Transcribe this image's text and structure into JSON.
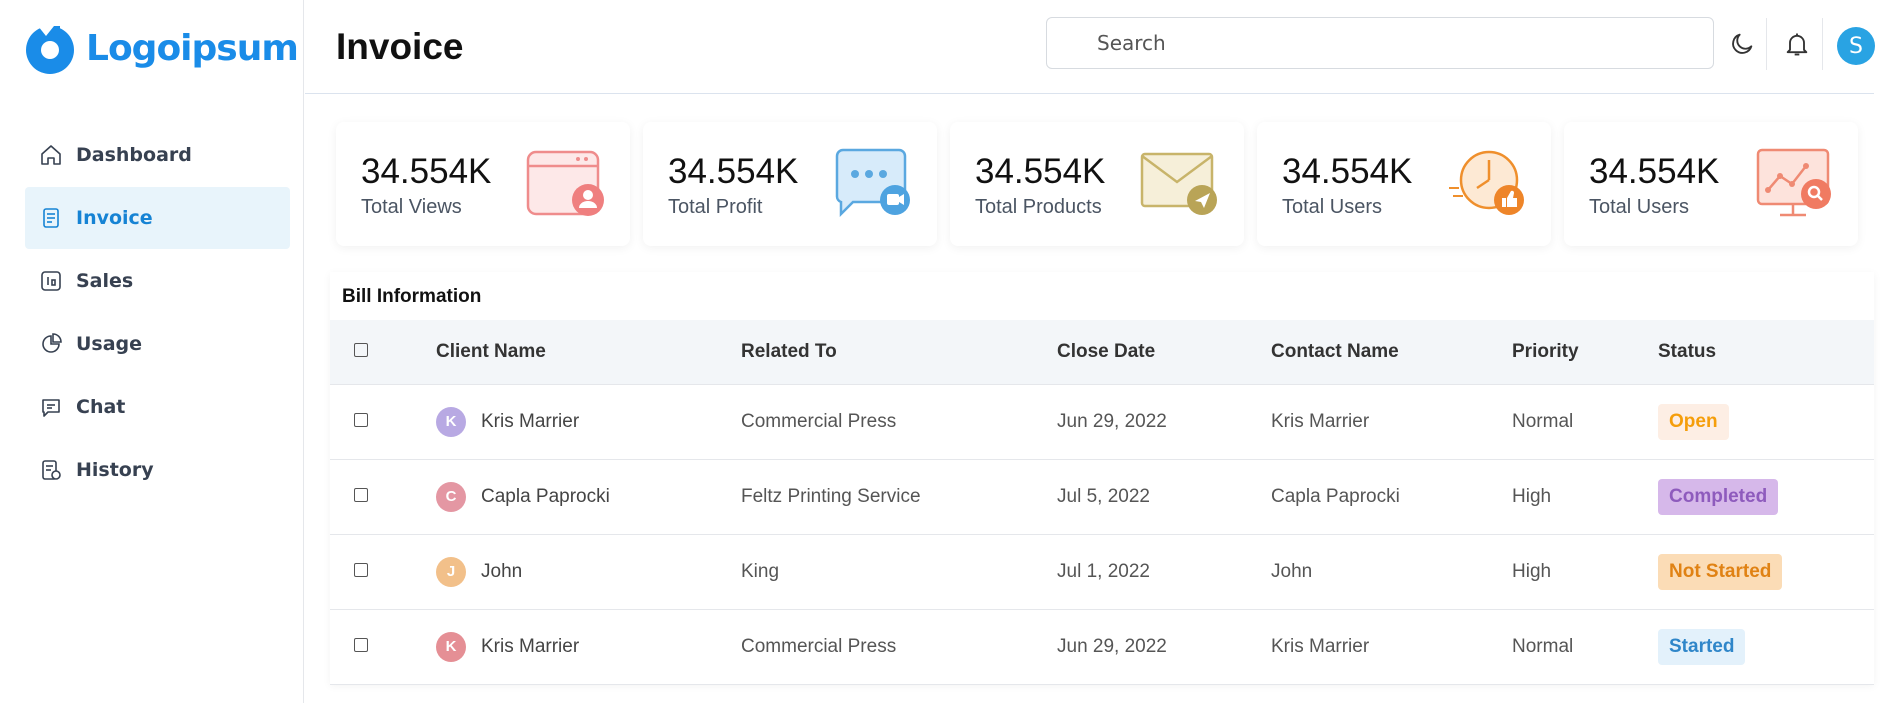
{
  "brand": {
    "name": "Logoipsum",
    "color": "#1a8ce8"
  },
  "sidebar": {
    "items": [
      {
        "label": "Dashboard",
        "icon": "home-icon",
        "active": false
      },
      {
        "label": "Invoice",
        "icon": "invoice-icon",
        "active": true
      },
      {
        "label": "Sales",
        "icon": "sales-icon",
        "active": false
      },
      {
        "label": "Usage",
        "icon": "pie-icon",
        "active": false
      },
      {
        "label": "Chat",
        "icon": "chat-icon",
        "active": false
      },
      {
        "label": "History",
        "icon": "history-icon",
        "active": false
      }
    ]
  },
  "header": {
    "title": "Invoice",
    "search_placeholder": "Search",
    "theme_icon": "moon-icon",
    "notification_icon": "bell-icon",
    "avatar_initial": "S"
  },
  "stats": [
    {
      "value": "34.554K",
      "label": "Total Views",
      "icon": "browser-user-icon"
    },
    {
      "value": "34.554K",
      "label": "Total Profit",
      "icon": "chat-video-icon"
    },
    {
      "value": "34.554K",
      "label": "Total Products",
      "icon": "envelope-send-icon"
    },
    {
      "value": "34.554K",
      "label": "Total Users",
      "icon": "clock-like-icon"
    },
    {
      "value": "34.554K",
      "label": "Total Users",
      "icon": "monitor-search-icon"
    }
  ],
  "bill": {
    "title": "Bill Information",
    "columns": [
      "Client Name",
      "Related To",
      "Close Date",
      "Contact Name",
      "Priority",
      "Status"
    ],
    "rows": [
      {
        "initial": "K",
        "avatar_color": "#b8a9e3",
        "client": "Kris Marrier",
        "related": "Commercial Press",
        "date": "Jun 29, 2022",
        "contact": "Kris Marrier",
        "priority": "Normal",
        "status": "Open",
        "status_fg": "#f59e0b",
        "status_bg": "#fdeee4"
      },
      {
        "initial": "C",
        "avatar_color": "#e497a3",
        "client": "Capla Paprocki",
        "related": "Feltz Printing Service",
        "date": "Jul 5, 2022",
        "contact": "Capla Paprocki",
        "priority": "High",
        "status": "Completed",
        "status_fg": "#8e5bbd",
        "status_bg": "#d6b8ea"
      },
      {
        "initial": "J",
        "avatar_color": "#f2c08a",
        "client": "John",
        "related": "King",
        "date": "Jul 1, 2022",
        "contact": "John",
        "priority": "High",
        "status": "Not Started",
        "status_fg": "#e08214",
        "status_bg": "#fbdcb6"
      },
      {
        "initial": "K",
        "avatar_color": "#e58f95",
        "client": "Kris Marrier",
        "related": "Commercial Press",
        "date": "Jun 29, 2022",
        "contact": "Kris Marrier",
        "priority": "Normal",
        "status": "Started",
        "status_fg": "#2f86c9",
        "status_bg": "#e3f1fb"
      }
    ]
  }
}
